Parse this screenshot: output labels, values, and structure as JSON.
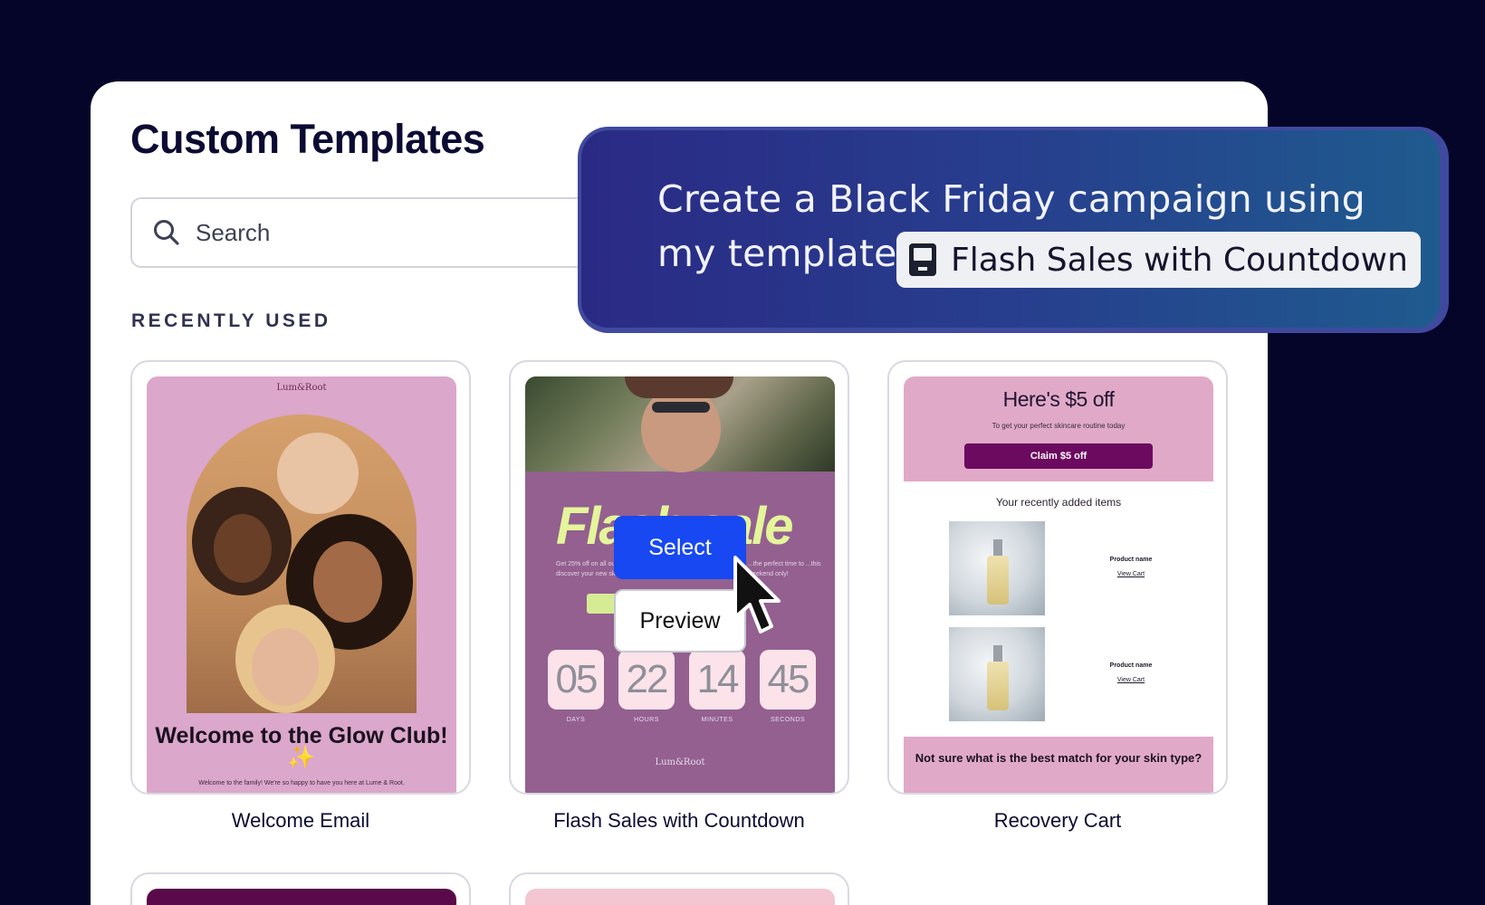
{
  "page": {
    "title": "Custom Templates"
  },
  "search": {
    "placeholder": "Search"
  },
  "section": {
    "label": "RECENTLY USED"
  },
  "templates": [
    {
      "name": "Welcome Email",
      "brand": "Lum&Root",
      "headline": "Welcome to the Glow Club! ✨",
      "subtext": "Welcome to the family! We're so happy to have you here at Lume & Root."
    },
    {
      "name": "Flash Sales with Countdown",
      "brand": "Lum&Root",
      "headline": "Flash sale",
      "copy_left": "Get 25% off on all ou... discover your new sk...",
      "copy_right": "...the perfect time to ...this weekend only!",
      "countdown": [
        {
          "value": "05",
          "label": "DAYS"
        },
        {
          "value": "22",
          "label": "HOURS"
        },
        {
          "value": "14",
          "label": "MINUTES"
        },
        {
          "value": "45",
          "label": "SECONDS"
        }
      ],
      "select_label": "Select",
      "preview_label": "Preview"
    },
    {
      "name": "Recovery Cart",
      "headline": "Here's $5 off",
      "subtext": "To get your perfect skincare routine today",
      "button": "Claim $5 off",
      "recent_label": "Your recently added items",
      "products": [
        {
          "name": "Product name",
          "link": "View Cart"
        },
        {
          "name": "Product name",
          "link": "View Cart"
        }
      ],
      "bottom_headline": "Not sure what is the best match for your skin type?"
    }
  ],
  "prompt": {
    "line1": "Create a Black Friday campaign using",
    "line2": "my template",
    "chip_label": "Flash Sales with Countdown"
  },
  "colors": {
    "background": "#05052a",
    "accent_blue": "#1748f2",
    "prompt_gradient_start": "#2a2a84",
    "prompt_gradient_end": "#1f5b8e",
    "welcome_pink": "#dba7cb",
    "flash_purple": "#936090",
    "flash_lime": "#e4f59a",
    "recovery_plum": "#6b0a5f"
  }
}
